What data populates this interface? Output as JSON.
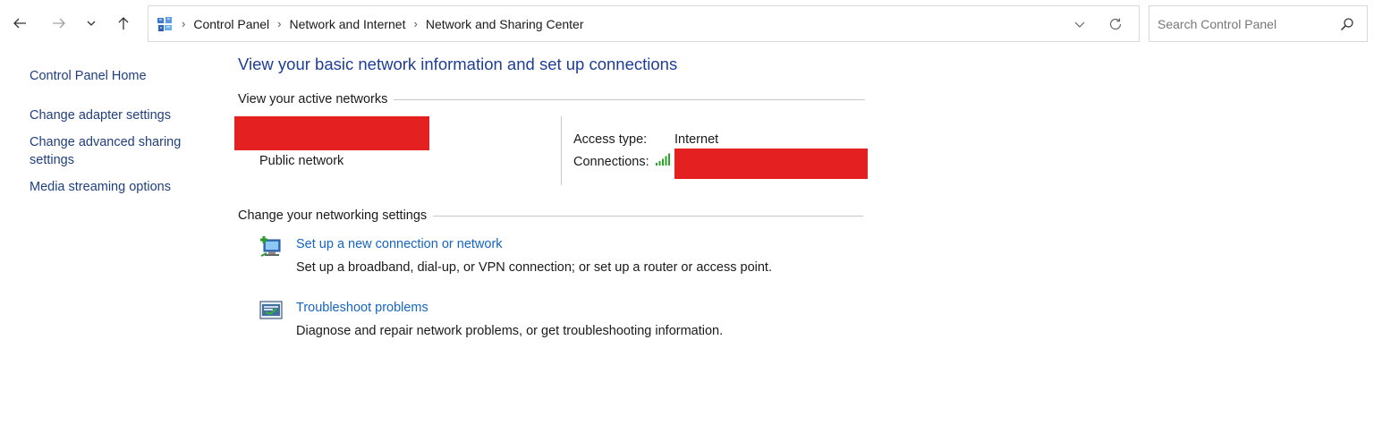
{
  "nav": {
    "back_icon": "arrow-left-icon",
    "forward_icon": "arrow-right-icon",
    "recent_icon": "chevron-down-icon",
    "up_icon": "arrow-up-icon"
  },
  "address": {
    "icon": "control-panel-icon",
    "breadcrumbs": [
      "Control Panel",
      "Network and Internet",
      "Network and Sharing Center"
    ],
    "dropdown_icon": "chevron-down-icon",
    "refresh_icon": "refresh-icon"
  },
  "search": {
    "placeholder": "Search Control Panel",
    "value": "",
    "icon": "search-icon"
  },
  "sidebar": {
    "home": "Control Panel Home",
    "items": [
      {
        "label_line1": "Change adapter settings",
        "label_line2": ""
      },
      {
        "label_line1": "Change advanced sharing",
        "label_line2": "settings"
      },
      {
        "label_line1": "Media streaming options",
        "label_line2": ""
      }
    ]
  },
  "main": {
    "title": "View your basic network information and set up connections",
    "active_networks": {
      "heading": "View your active networks",
      "network_type": "Public network",
      "access_type_label": "Access type:",
      "access_type_value": "Internet",
      "connections_label": "Connections:",
      "connection_icon": "wifi-signal-icon"
    },
    "networking_settings": {
      "heading": "Change your networking settings",
      "tasks": [
        {
          "icon": "new-connection-icon",
          "link": "Set up a new connection or network",
          "description": "Set up a broadband, dial-up, or VPN connection; or set up a router or access point."
        },
        {
          "icon": "troubleshoot-icon",
          "link": "Troubleshoot problems",
          "description": "Diagnose and repair network problems, or get troubleshooting information."
        }
      ]
    }
  },
  "colors": {
    "title": "#1e3e96",
    "link": "#1565c0",
    "redaction": "#e52020"
  }
}
